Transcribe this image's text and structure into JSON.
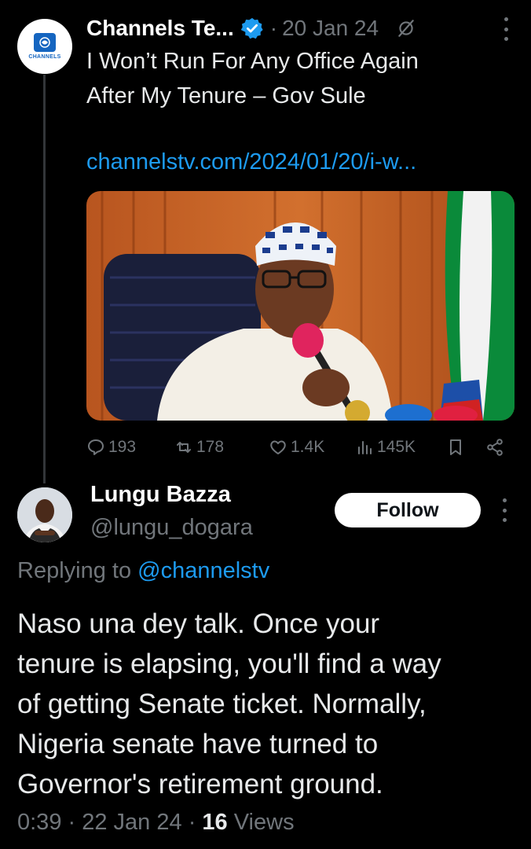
{
  "tweet": {
    "author_name": "Channels Te...",
    "avatar_text": "CHANNELS",
    "date": "20 Jan 24",
    "separator": "·",
    "text": "I Won’t Run For Any Office Again\nAfter My Tenure – Gov Sule",
    "link": "channelstv.com/2024/01/20/i-w...",
    "actions": {
      "replies": "193",
      "reposts": "178",
      "likes": "1.4K",
      "views": "145K"
    }
  },
  "reply": {
    "name": "Lungu Bazza",
    "handle": "@lungu_dogara",
    "follow_label": "Follow",
    "replying_prefix": "Replying to ",
    "replying_mention": "@channelstv",
    "text": "Naso una dey talk. Once your\ntenure is elapsing, you'll find a way\nof getting Senate ticket. Normally,\nNigeria senate have turned to\nGovernor's retirement ground.",
    "time": "0:39",
    "date": "22 Jan 24",
    "views_count": "16",
    "views_label": "Views"
  },
  "colors": {
    "background": "#000000",
    "accent": "#1d9bf0",
    "secondary_text": "#71767b",
    "primary_text": "#e7e9ea"
  },
  "icons": [
    "verified-badge-icon",
    "grok-icon",
    "more-icon",
    "reply-icon",
    "repost-icon",
    "like-icon",
    "views-icon",
    "bookmark-icon",
    "share-icon"
  ]
}
